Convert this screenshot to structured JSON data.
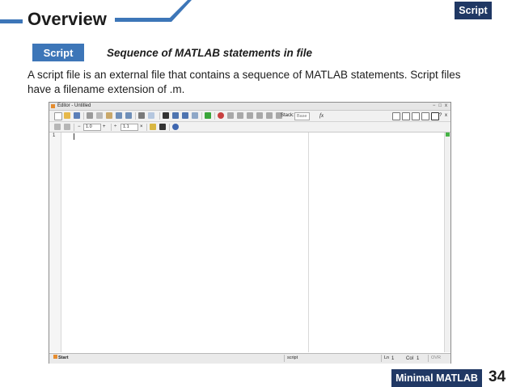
{
  "slide": {
    "title": "Overview",
    "corner_tag": "Script",
    "chip_label": "Script",
    "subtitle": "Sequence of MATLAB statements in file",
    "body": "A script file is an external file that contains a sequence of MATLAB statements. Script files have a filename extension of .m.",
    "footer_label": "Minimal MATLAB",
    "page_number": "34"
  },
  "colors": {
    "accent_blue": "#3d76b8",
    "dark_navy": "#203864"
  },
  "editor": {
    "window_title": "Editor - Untitled",
    "window_buttons": [
      "−",
      "□",
      "x"
    ],
    "window_buttons_right": [
      "?",
      "x"
    ],
    "toolbar1": {
      "stack_label": "Stack:",
      "stack_value": "Base",
      "fx_label": "fx"
    },
    "toolbar2": {
      "minus_label": "−",
      "cell_value_1": "1.0",
      "plus_label": "+",
      "divide_label": "÷",
      "cell_value_2": "1.1",
      "times_label": "×"
    },
    "line_numbers": [
      "1"
    ],
    "status": {
      "start_label": "Start",
      "file_type": "script",
      "ln_label": "Ln",
      "ln_value": "1",
      "col_label": "Col",
      "col_value": "1",
      "ovr_label": "OVR"
    }
  }
}
